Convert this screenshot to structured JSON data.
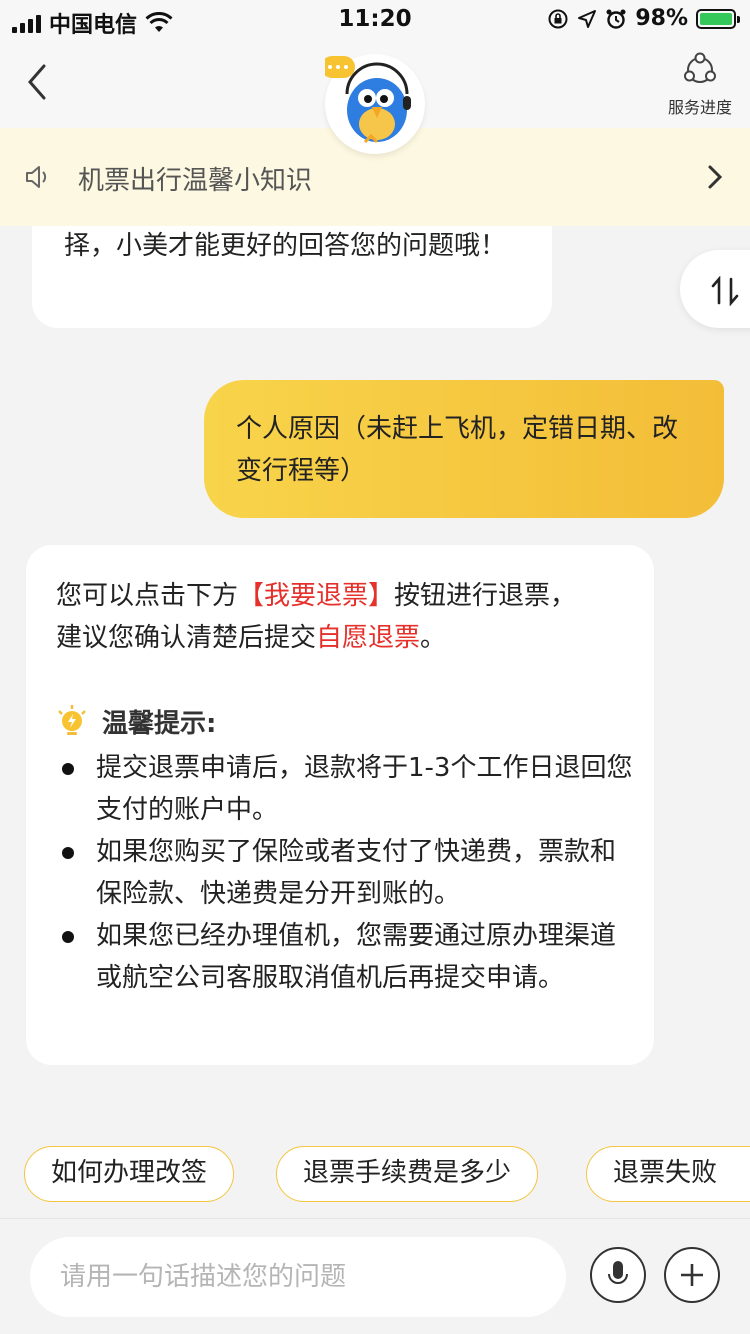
{
  "status_bar": {
    "carrier": "中国电信",
    "time": "11:20",
    "battery": "98%"
  },
  "header": {
    "service_label": "服务进度"
  },
  "notice": {
    "text": "机票出行温馨小知识"
  },
  "messages": {
    "bot_partial": "择，小美才能更好的回答您的问题哦！",
    "user": "个人原因（未赶上飞机，定错日期、改变行程等）",
    "bot_reply": {
      "line1_pre": "您可以点击下方",
      "line1_red": "【我要退票】",
      "line1_post": "按钮进行退票，",
      "line2_pre": "建议您确认清楚后提交",
      "line2_red": "自愿退票",
      "line2_post": "。",
      "tip_title": "温馨提示:",
      "tips": [
        "提交退票申请后，退款将于1-3个工作日退回您支付的账户中。",
        "如果您购买了保险或者支付了快递费，票款和保险款、快递费是分开到账的。",
        "如果您已经办理值机，您需要通过原办理渠道或航空公司客服取消值机后再提交申请。"
      ]
    }
  },
  "quick_replies": [
    "如何办理改签",
    "退票手续费是多少",
    "退票失败"
  ],
  "input": {
    "placeholder": "请用一句话描述您的问题"
  },
  "colors": {
    "accent_yellow": "#f3c540",
    "highlight_red": "#e5302b",
    "notice_bg": "#fdf8e1"
  },
  "icons": [
    "signal-icon",
    "wifi-icon",
    "lock-rotation-icon",
    "location-icon",
    "alarm-icon",
    "battery-icon",
    "back-chevron-icon",
    "mascot-avatar",
    "service-progress-icon",
    "speaker-icon",
    "chevron-right-icon",
    "sort-icon",
    "lightbulb-icon",
    "mic-icon",
    "plus-icon"
  ]
}
